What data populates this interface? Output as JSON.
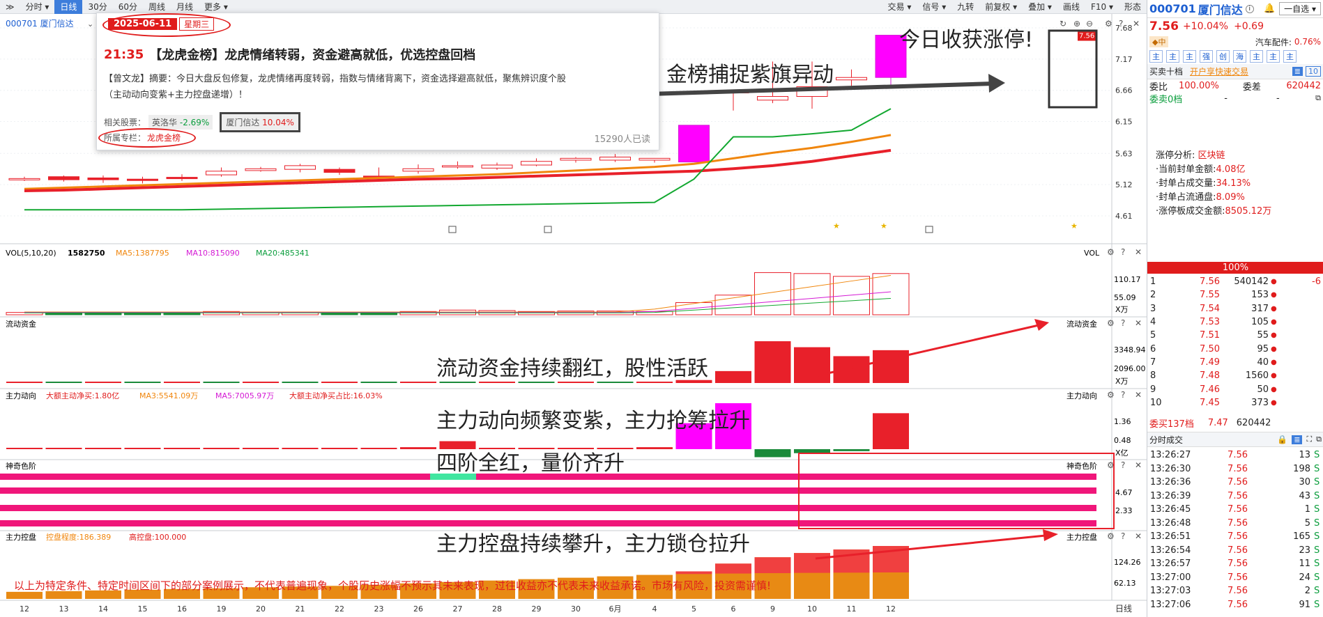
{
  "toolbar": {
    "items": [
      "分时",
      "日线",
      "30分",
      "60分",
      "周线",
      "月线",
      "更多"
    ],
    "active": "日线",
    "right": [
      "交易",
      "信号",
      "九转",
      "前复权",
      "叠加",
      "画线",
      "F10",
      "形态"
    ],
    "expand": "≫"
  },
  "chart_header": {
    "code_name": "000701 厦门信达"
  },
  "price_axis": [
    "7.68",
    "7.17",
    "6.66",
    "6.15",
    "5.63",
    "5.12",
    "4.61"
  ],
  "last_price_tag": "7.56",
  "panels": {
    "vol": {
      "title": "VOL(5,10,20)",
      "value": "1582750",
      "ma5": "MA5:1387795",
      "ma10": "MA10:815090",
      "ma20": "MA20:485341",
      "right_label": "VOL",
      "axis": [
        "110.17",
        "55.09",
        "X万"
      ]
    },
    "liquid": {
      "title": "流动资金",
      "right_label": "流动资金",
      "axis": [
        "3348.94",
        "2096.00",
        "X万"
      ]
    },
    "main_force": {
      "title": "主力动向",
      "a": "大额主动净买:1.80亿",
      "b": "MA3:5541.09万",
      "c": "MA5:7005.97万",
      "d": "大额主动净买占比:16.03%",
      "right_label": "主力动向",
      "axis": [
        "1.36",
        "0.48",
        "X亿"
      ]
    },
    "magic": {
      "title": "神奇色阶",
      "right_label": "神奇色阶",
      "axis": [
        "4.67",
        "2.33"
      ]
    },
    "control": {
      "title": "主力控盘",
      "a": "控盘程度:186.389",
      "b": "高控盘:100.000",
      "right_label": "主力控盘",
      "axis": [
        "124.26",
        "62.13"
      ]
    }
  },
  "x_axis": [
    "12",
    "13",
    "14",
    "15",
    "16",
    "19",
    "20",
    "21",
    "22",
    "23",
    "26",
    "27",
    "28",
    "29",
    "30",
    "6月",
    "4",
    "5",
    "6",
    "9",
    "10",
    "11",
    "12"
  ],
  "x_axis_right": "日线",
  "annotations": {
    "limit_up": "今日收获涨停!",
    "purple_flag": "金榜捕捉紫旗异动",
    "liquid": "流动资金持续翻红，股性活跃",
    "main_force": "主力动向频繁变紫，主力抢筹拉升",
    "four_red": "四阶全红，量价齐升",
    "control": "主力控盘持续攀升，主力锁仓拉升",
    "disclaimer": "以上为特定条件、特定时间区间下的部分案例展示，不代表普遍现象，个股历史涨幅不预示其未来表现，过往收益亦不代表未来收益承诺。市场有风险，投资需谨慎!"
  },
  "popup": {
    "date": "2025-06-11",
    "weekday": "星期三",
    "time": "21:35",
    "headline": "【龙虎金榜】龙虎情绪转弱，资金避高就低，优选控盘回档",
    "summary1": "【曾文龙】摘要：今日大盘反包修复，龙虎情绪再度转弱，指数与情绪背离下，资金选择避高就低，聚焦辨识度个股",
    "summary2": "（主动动向变紫+主力控盘递增）！",
    "related_label": "相关股票：",
    "stock1": "英洛华",
    "stock1_pct": "-2.69%",
    "stock2": "厦门信达",
    "stock2_pct": "10.04%",
    "column_label": "所属专栏：",
    "column": "龙虎金榜",
    "reads": "15290人已读"
  },
  "quote": {
    "code": "000701",
    "name": "厦门信达",
    "icon": "i",
    "self": "一自选",
    "price": "7.56",
    "pct": "+10.04%",
    "chg": "+0.69",
    "badge": "中",
    "sector": "汽车配件:",
    "sector_pct": "0.76%",
    "tabs": [
      "主",
      "主",
      "主",
      "强",
      "创",
      "海",
      "主",
      "主",
      "主"
    ],
    "mm_title": "买卖十档",
    "mm_link": "开户享快速交易",
    "weibi_label": "委比",
    "weibi": "100.00%",
    "weicha_label": "委差",
    "weicha": "620442",
    "sell_label": "委卖0档",
    "sell_dash1": "-",
    "sell_dash2": "-"
  },
  "limit_analysis": {
    "title": "涨停分析:",
    "title_val": "区块链",
    "rows": [
      [
        "·当前封单金额:",
        "4.08亿"
      ],
      [
        "·封单占成交量:",
        "34.13%"
      ],
      [
        "·封单占流通盘:",
        "8.09%"
      ],
      [
        "·涨停板成交金额:",
        "8505.12万"
      ]
    ]
  },
  "bar100": "100%",
  "bids": [
    [
      "1",
      "7.56",
      "540142",
      "-6"
    ],
    [
      "2",
      "7.55",
      "153",
      ""
    ],
    [
      "3",
      "7.54",
      "317",
      ""
    ],
    [
      "4",
      "7.53",
      "105",
      ""
    ],
    [
      "5",
      "7.51",
      "55",
      ""
    ],
    [
      "6",
      "7.50",
      "95",
      ""
    ],
    [
      "7",
      "7.49",
      "40",
      ""
    ],
    [
      "8",
      "7.48",
      "1560",
      ""
    ],
    [
      "9",
      "7.46",
      "50",
      ""
    ],
    [
      "10",
      "7.45",
      "373",
      ""
    ]
  ],
  "buy_summary": {
    "label": "委买137档",
    "price": "7.47",
    "vol": "620442"
  },
  "trades_title": "分时成交",
  "trades": [
    [
      "13:26:27",
      "7.56",
      "13",
      "S"
    ],
    [
      "13:26:30",
      "7.56",
      "198",
      "S"
    ],
    [
      "13:26:36",
      "7.56",
      "30",
      "S"
    ],
    [
      "13:26:39",
      "7.56",
      "43",
      "S"
    ],
    [
      "13:26:45",
      "7.56",
      "1",
      "S"
    ],
    [
      "13:26:48",
      "7.56",
      "5",
      "S"
    ],
    [
      "13:26:51",
      "7.56",
      "165",
      "S"
    ],
    [
      "13:26:54",
      "7.56",
      "23",
      "S"
    ],
    [
      "13:26:57",
      "7.56",
      "11",
      "S"
    ],
    [
      "13:27:00",
      "7.56",
      "24",
      "S"
    ],
    [
      "13:27:03",
      "7.56",
      "2",
      "S"
    ],
    [
      "13:27:06",
      "7.56",
      "91",
      "S"
    ]
  ],
  "chart_data": {
    "type": "candlestick",
    "categories": [
      "12",
      "13",
      "14",
      "15",
      "16",
      "19",
      "20",
      "21",
      "22",
      "23",
      "26",
      "27",
      "28",
      "29",
      "30",
      "6月",
      "4",
      "5",
      "6",
      "9",
      "10",
      "11",
      "12"
    ],
    "open": [
      5.2,
      5.25,
      5.23,
      5.21,
      5.24,
      5.28,
      5.35,
      5.37,
      5.37,
      5.26,
      5.34,
      5.41,
      5.39,
      5.44,
      5.52,
      5.52,
      5.52,
      5.49,
      6.64,
      6.5,
      6.56,
      6.83,
      6.87
    ],
    "high": [
      5.25,
      5.27,
      5.27,
      5.25,
      5.29,
      5.4,
      5.41,
      5.46,
      5.4,
      5.4,
      5.45,
      5.5,
      5.48,
      5.55,
      5.57,
      5.62,
      5.55,
      6.09,
      6.66,
      7.13,
      7.13,
      7.0,
      7.56
    ],
    "close": [
      5.22,
      5.2,
      5.2,
      5.19,
      5.22,
      5.34,
      5.38,
      5.43,
      5.32,
      5.24,
      5.38,
      5.43,
      5.44,
      5.5,
      5.55,
      5.57,
      5.55,
      6.09,
      6.64,
      6.56,
      6.72,
      6.87,
      7.56
    ],
    "low": [
      5.18,
      5.17,
      5.15,
      5.14,
      5.18,
      5.25,
      5.33,
      5.32,
      5.28,
      5.2,
      5.3,
      5.38,
      5.36,
      5.42,
      5.48,
      5.49,
      5.48,
      5.49,
      6.33,
      6.45,
      6.36,
      6.71,
      6.75
    ],
    "ma_orange": [
      5.05,
      5.07,
      5.09,
      5.11,
      5.13,
      5.15,
      5.17,
      5.19,
      5.21,
      5.23,
      5.25,
      5.27,
      5.29,
      5.32,
      5.35,
      5.38,
      5.41,
      5.46,
      5.55,
      5.64,
      5.72,
      5.82,
      5.93
    ],
    "ma_red": [
      5.02,
      5.03,
      5.05,
      5.07,
      5.09,
      5.11,
      5.13,
      5.15,
      5.17,
      5.19,
      5.21,
      5.22,
      5.24,
      5.26,
      5.28,
      5.3,
      5.32,
      5.34,
      5.38,
      5.43,
      5.5,
      5.59,
      5.68
    ],
    "ma_green": [
      4.71,
      4.71,
      4.71,
      4.71,
      4.71,
      4.72,
      4.73,
      4.74,
      4.75,
      4.76,
      4.77,
      4.78,
      4.79,
      4.8,
      4.81,
      4.82,
      4.83,
      5.21,
      5.9,
      5.9,
      5.95,
      6.01,
      6.36
    ],
    "volume": [
      5,
      6,
      6,
      5,
      5,
      7,
      6,
      6,
      5,
      6,
      7,
      10,
      9,
      7,
      8,
      8,
      7,
      26,
      42,
      90,
      88,
      82,
      88
    ],
    "liquid": [
      0,
      0,
      0,
      0,
      0,
      0,
      0,
      0,
      0,
      0,
      0,
      0,
      0,
      0,
      0,
      0,
      0,
      1,
      4,
      14,
      12,
      9,
      11
    ],
    "mainforce": [
      0,
      0,
      0,
      0,
      0,
      0,
      0,
      0,
      0,
      0,
      0.1,
      0.4,
      0,
      0,
      0,
      0,
      0.1,
      1.3,
      2.3,
      -0.4,
      -0.2,
      -0.1,
      1.8
    ],
    "control": [
      20,
      22,
      24,
      26,
      28,
      30,
      33,
      35,
      37,
      40,
      44,
      48,
      52,
      56,
      60,
      64,
      68,
      78,
      100,
      118,
      130,
      140,
      150
    ]
  }
}
